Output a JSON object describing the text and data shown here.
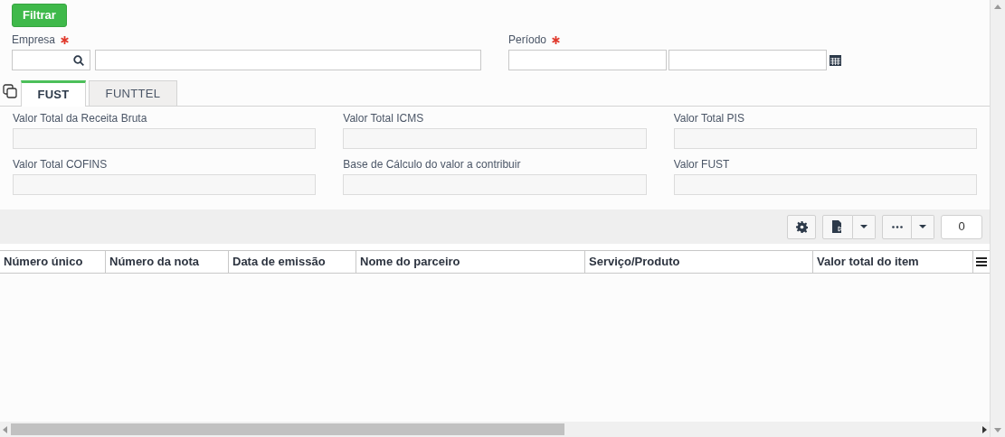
{
  "filter_button": "Filtrar",
  "filters": [
    {
      "label": "Empresa",
      "required": true,
      "kind": "lookup"
    },
    {
      "label": "Período",
      "required": true,
      "kind": "daterange"
    }
  ],
  "tabs": [
    {
      "label": "FUST",
      "selected": true
    },
    {
      "label": "FUNTTEL",
      "selected": false
    }
  ],
  "totals": [
    {
      "label": "Valor Total da Receita Bruta"
    },
    {
      "label": "Valor Total ICMS"
    },
    {
      "label": "Valor Total PIS"
    },
    {
      "label": "Valor Total COFINS"
    },
    {
      "label": "Base de Cálculo do valor a contribuir"
    },
    {
      "label": "Valor FUST"
    }
  ],
  "toolbar": {
    "count": "0"
  },
  "table": {
    "columns": [
      "Número único",
      "Número da nota",
      "Data de emissão",
      "Nome do parceiro",
      "Serviço/Produto",
      "Valor total do item"
    ]
  }
}
